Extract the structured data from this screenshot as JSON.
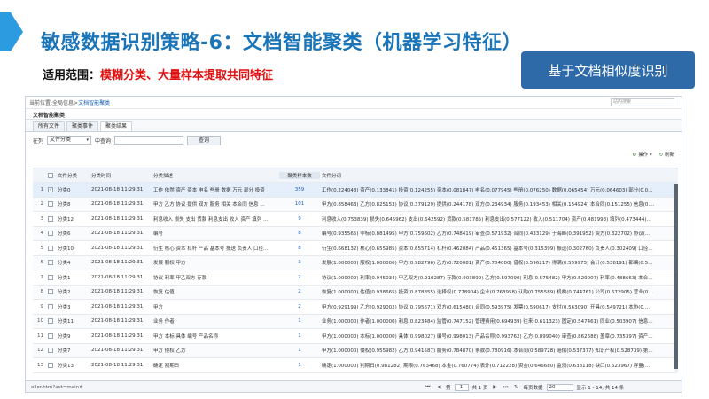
{
  "slide": {
    "title": "敏感数据识别策略-6：文档智能聚类（机器学习特征）",
    "scope_label": "适用范围：",
    "scope_value": "模糊分类、大量样本提取共同特征",
    "badge": "基于文档相似度识别",
    "colors": {
      "title": "#1a74b8",
      "scope_value": "#e01010",
      "badge_bg": "#2f6aa8"
    }
  },
  "app": {
    "breadcrumb_prefix": "当前位置:全局信息>",
    "breadcrumb_link": "文档智能聚类",
    "search_placeholder": "站内搜索",
    "page_title": "文档智能聚类",
    "tabs": [
      {
        "label": "所有文件"
      },
      {
        "label": "聚类事件"
      },
      {
        "label": "聚类结果"
      }
    ],
    "filter": {
      "in_label": "在列",
      "select_value": "文件分类",
      "contains_label": "中查询",
      "query_button": "查询"
    },
    "toolbar": {
      "action_label": "操作",
      "refresh_label": "刷新"
    },
    "columns": {
      "category": "文件分类",
      "time": "分类时间",
      "desc": "分类描述",
      "count": "聚类样本数",
      "words": "文件分词"
    },
    "rows": [
      {
        "num": "1",
        "checked": "✓",
        "category": "分类0",
        "time": "2021-08-18 11:29:31",
        "desc": "工作 依然 资产 资本 申名 些册 数据 万元 部分 投资",
        "count": "359",
        "words": "工作(0.224043) 资产(0.133841) 投资(0.124255) 资本(0.081847) 申名(0.077945) 些册(0.076250) 数据(0.065454) 万元(0.064603) 部分(0.0…"
      },
      {
        "num": "2",
        "checked": "",
        "category": "分类8",
        "time": "2021-08-18 11:29:31",
        "desc": "甲方 乙方 协议 提供 双方 服务 相关 本合同 信息 …",
        "count": "101",
        "words": "甲方(0.858463) 乙方(0.825153) 协议(0.379129) 提供(0.244178) 双方(0.234934) 服务(0.193453) 相关(0.154924) 本合同(0.151255) 信息(0.…"
      },
      {
        "num": "3",
        "checked": "",
        "category": "分类12",
        "time": "2021-08-18 11:29:31",
        "desc": "利息收入 损失 支出 货款 利息支出 收入 资产 填列 …",
        "count": "9",
        "words": "利息收入(0.753839) 损失(0.645962) 支出(0.642592) 货款(0.581785) 利息支出(0.577122) 收入(0.511704) 资产(0.481993) 填列(0.473444)…"
      },
      {
        "num": "4",
        "checked": "",
        "category": "分类6",
        "time": "2021-08-18 11:29:31",
        "desc": "编号",
        "count": "8",
        "words": "编号(0.935565) 非标(0.881495) 甲方(0.759602) 乙方(0.748419) 审查(0.571932) 合同(0.433129) 于海峰(0.391952) 资方(0.322702) 协议(…"
      },
      {
        "num": "5",
        "checked": "",
        "category": "分类10",
        "time": "2021-08-18 11:29:31",
        "desc": "衍生 核心 资本 杠杆 产品 基本号 振送 负责人 口径…",
        "count": "8",
        "words": "衍生(0.668132) 核心(0.655985) 资本(0.655714) 杠杆(0.462084) 产品(0.451365) 基本号(0.315399) 振送(0.302760) 负责人(0.302409) 口径…"
      },
      {
        "num": "6",
        "checked": "",
        "category": "分类4",
        "time": "2021-08-18 11:29:31",
        "desc": "发展 服权 甲方",
        "count": "3",
        "words": "发展(1.000000) 服权(1.000000) 甲方(0.982796) 乙方(0.720081) 资产(0.704000) 借权(0.596217) 得满(0.559975) 会计(0.536191) 都编(0.5…"
      },
      {
        "num": "7",
        "checked": "",
        "category": "分类1",
        "time": "2021-08-18 11:29:31",
        "desc": "协议 利率 甲乙双方 存款",
        "count": "2",
        "words": "协议(1.000000) 利率(0.945034) 甲乙双方(0.910287) 存款(0.903899) 乙方(0.597090) 利息(0.575482) 甲方(0.529007) 利率(0.488663) 本合…"
      },
      {
        "num": "8",
        "checked": "",
        "category": "分类2",
        "time": "2021-08-18 11:29:31",
        "desc": "恢复 估值",
        "count": "2",
        "words": "恢复(1.000000) 估值(0.938665) 投资(0.878855) 选择权(0.778904) 企业(0.763958) 认购(0.755589) 机构(0.744761) 公司(0.672905) 营业(0…"
      },
      {
        "num": "9",
        "checked": "",
        "category": "分类3",
        "time": "2021-08-18 11:29:31",
        "desc": "甲方",
        "count": "2",
        "words": "甲方(0.929199) 乙方(0.929002) 协议(0.795671) 双方(0.615480) 合同(0.593975) 发票(0.590617) 支付(0.563090) 开具(0.549721) 本协(0.…"
      },
      {
        "num": "10",
        "checked": "",
        "category": "分类11",
        "time": "2021-08-18 11:29:31",
        "desc": "业务 作者",
        "count": "1",
        "words": "业务(1.000000) 作者(1.000000) 利息(0.823484) 监管(0.747152) 管理费用(0.694939) 往来(0.611323) 固定(0.547461) 同业(0.503907) 信息…"
      },
      {
        "num": "11",
        "checked": "",
        "category": "分类9",
        "time": "2021-08-18 11:29:31",
        "desc": "甲方 本标 具体 编号 产品名称",
        "count": "1",
        "words": "甲方(1.000000) 本标(1.000000) 具体(0.998027) 编号(0.998013) 产品名称(0.993762) 乙方(0.899040) 审查(0.862688) 盖章(0.735397) 资产…"
      },
      {
        "num": "12",
        "checked": "",
        "category": "分类7",
        "time": "2021-08-18 11:29:31",
        "desc": "甲方 侵权 乙方",
        "count": "1",
        "words": "甲方(1.000000) 侵权(0.955982) 乙方(0.941587) 服务(0.784870) 条款(0.780916) 本合同(0.589728) 赔偿(0.537377) 知识产权(0.528739) 第…"
      },
      {
        "num": "13",
        "checked": "",
        "category": "分类13",
        "time": "2021-08-18 11:29:31",
        "desc": "确定 别期日",
        "count": "1",
        "words": "确定(1.000000) 别期日(0.981282) 期限(0.763468) 本金(0.760774) 表外(0.712228) 资金(0.646680) 监测(0.638118) 缺口(0.623967) 存量(…"
      },
      {
        "num": "14",
        "checked": "",
        "category": "分类5",
        "time": "2021-08-18 11:29:31",
        "desc": "本合同 本标 本协",
        "count": "1",
        "words": "本合同(1.000000) 本标(1.000000) 本协(0.943765) 编号(0.876190) 甲方(0.743805) 乙方(0.712740) 盖章(0.675829) 签署(0.572618) 双…"
      }
    ],
    "status": {
      "url": "oller.htm?act=main#",
      "page_label": "第",
      "page_value": "1",
      "total_pages": "共 1 页",
      "page_size_label": "每页数据",
      "page_size": "20",
      "range": "显示 1 - 14, 共 14 条"
    }
  }
}
